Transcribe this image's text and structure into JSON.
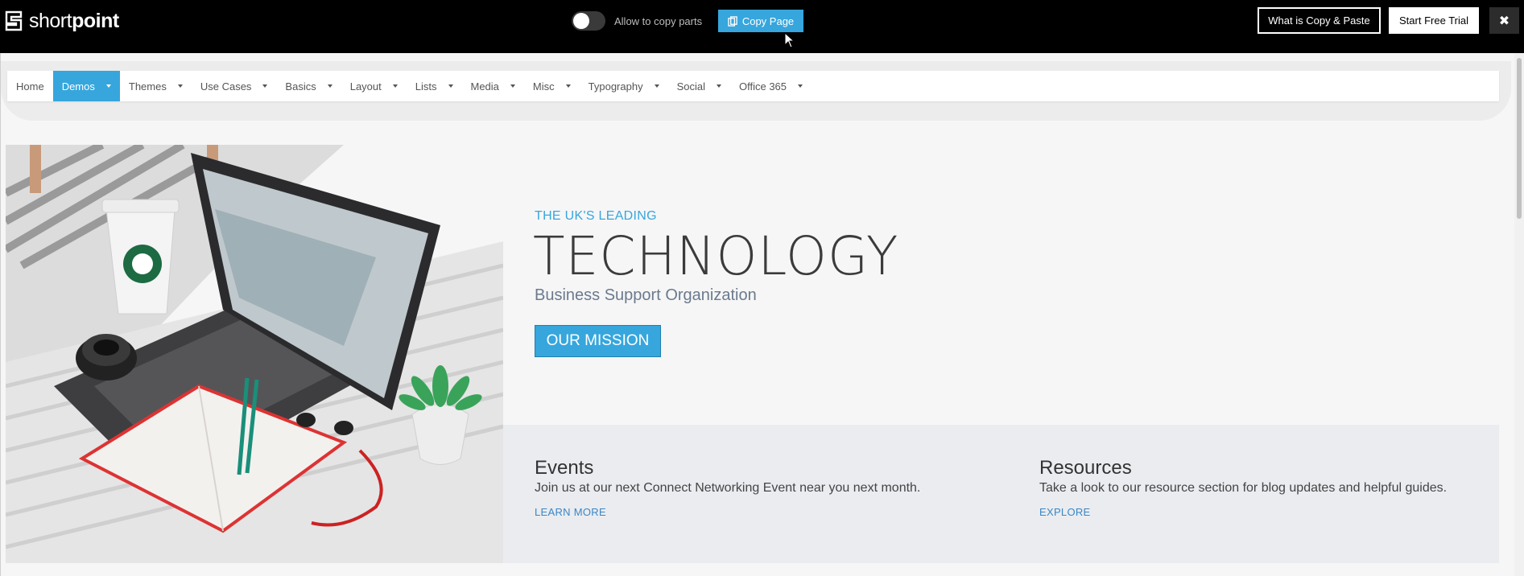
{
  "topbar": {
    "logo": {
      "text_light": "short",
      "text_bold": "point"
    },
    "toggle_label": "Allow to copy parts",
    "copy_page_label": "Copy Page",
    "what_is_label": "What is Copy & Paste",
    "trial_label": "Start Free Trial",
    "close_label": "✖"
  },
  "nav": {
    "items": [
      {
        "label": "Home",
        "active": false,
        "dropdown": false
      },
      {
        "label": "Demos",
        "active": true,
        "dropdown": true
      },
      {
        "label": "Themes",
        "active": false,
        "dropdown": true
      },
      {
        "label": "Use Cases",
        "active": false,
        "dropdown": true
      },
      {
        "label": "Basics",
        "active": false,
        "dropdown": true
      },
      {
        "label": "Layout",
        "active": false,
        "dropdown": true
      },
      {
        "label": "Lists",
        "active": false,
        "dropdown": true
      },
      {
        "label": "Media",
        "active": false,
        "dropdown": true
      },
      {
        "label": "Misc",
        "active": false,
        "dropdown": true
      },
      {
        "label": "Typography",
        "active": false,
        "dropdown": true
      },
      {
        "label": "Social",
        "active": false,
        "dropdown": true
      },
      {
        "label": "Office 365",
        "active": false,
        "dropdown": true
      }
    ]
  },
  "hero": {
    "eyebrow": "THE UK'S LEADING",
    "headline": "TECHNOLOGY",
    "subline": "Business Support Organization",
    "cta_label": "OUR MISSION"
  },
  "info": {
    "events": {
      "title": "Events",
      "text": "Join us at our next Connect Networking Event near you next month.",
      "link": "LEARN MORE"
    },
    "resources": {
      "title": "Resources",
      "text": "Take a look to our resource section for blog updates and helpful guides.",
      "link": "EXPLORE"
    }
  },
  "colors": {
    "accent": "#36a6dd",
    "topbar_bg": "#000000",
    "page_bg": "#f6f6f7",
    "panel_bg": "#eaecf0"
  },
  "icons": [
    "shortpoint-logo-icon",
    "copy-icon",
    "mouse-cursor-icon",
    "close-icon",
    "caret-down-icon"
  ]
}
